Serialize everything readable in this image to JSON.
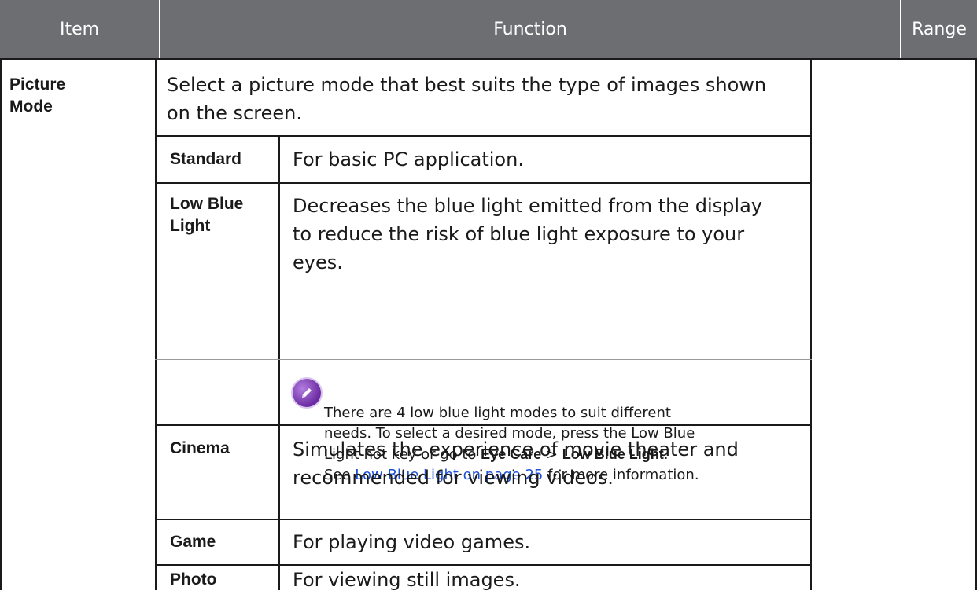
{
  "header": {
    "item": "Item",
    "function": "Function",
    "range": "Range"
  },
  "picture_mode": {
    "label_line1": "Picture",
    "label_line2": "Mode",
    "description_line1": "Select a picture mode that best suits the type of images shown",
    "description_line2": "on the screen."
  },
  "modes": [
    {
      "name": "Standard",
      "desc": "For basic PC application."
    },
    {
      "name_line1": "Low Blue",
      "name_line2": "Light",
      "desc_line1": "Decreases the blue light emitted from the display",
      "desc_line2": "to reduce the risk of blue light exposure to your",
      "desc_line3": "eyes."
    },
    {
      "name": "Cinema",
      "desc_line1": "Simulates the experience of movie theater and",
      "desc_line2": "recommended for viewing videos."
    },
    {
      "name": "Game",
      "desc": "For playing video games."
    },
    {
      "name": "Photo",
      "desc": "For viewing still images."
    }
  ],
  "note": {
    "icon": "pencil-icon",
    "line1": "There are 4 low blue light modes to suit different",
    "line2": "needs. To select a desired mode, press the Low Blue",
    "line3_a": "Light hot key or go to ",
    "line3_b": "Eye Care",
    "line3_c": " > ",
    "line3_d": "Low Blue Light",
    "line3_e": ".",
    "line4_a": "See ",
    "line4_link": "Low Blue Light on page 25",
    "line4_b": " for more information."
  },
  "colors": {
    "header_bg": "#6d6e71",
    "link": "#1a4fd6",
    "icon_purple": "#7b3fb5"
  }
}
